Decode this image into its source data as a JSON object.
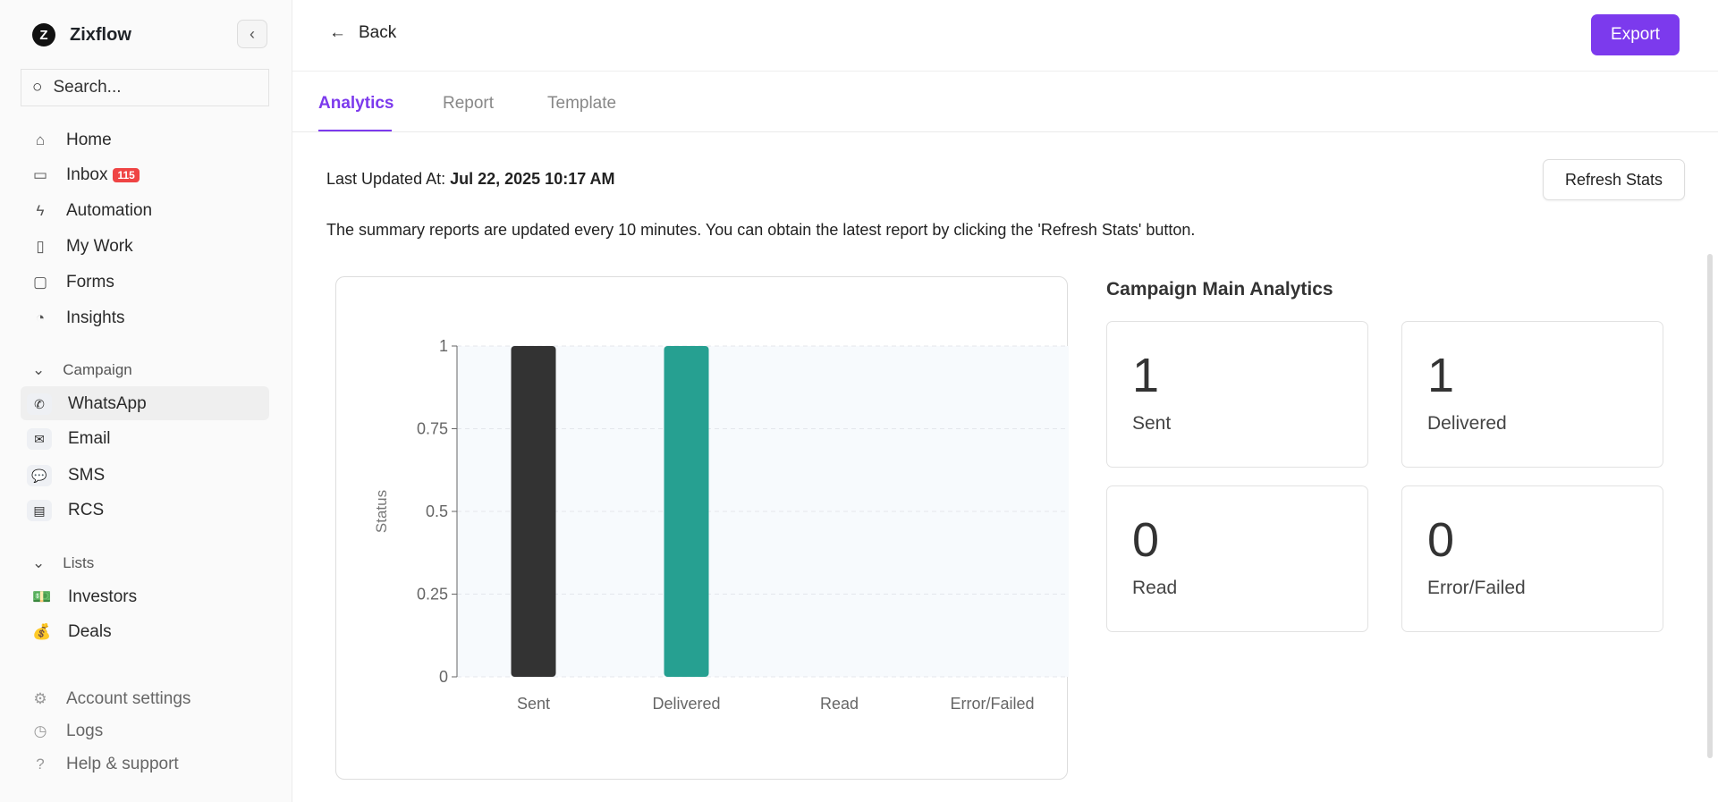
{
  "sidebar": {
    "brand": "Zixflow",
    "search_placeholder": "Search...",
    "nav": [
      {
        "label": "Home",
        "icon": "home-icon"
      },
      {
        "label": "Inbox",
        "icon": "inbox-icon",
        "badge": "115"
      },
      {
        "label": "Automation",
        "icon": "bolt-icon"
      },
      {
        "label": "My Work",
        "icon": "panel-icon"
      },
      {
        "label": "Forms",
        "icon": "file-icon"
      },
      {
        "label": "Insights",
        "icon": "pie-chart-icon"
      }
    ],
    "campaign_section": "Campaign",
    "campaign": [
      {
        "label": "WhatsApp",
        "icon": "whatsapp-icon",
        "active": true
      },
      {
        "label": "Email",
        "icon": "email-icon"
      },
      {
        "label": "SMS",
        "icon": "sms-icon"
      },
      {
        "label": "RCS",
        "icon": "rcs-icon"
      }
    ],
    "lists_section": "Lists",
    "lists": [
      {
        "label": "Investors",
        "icon": "money-icon"
      },
      {
        "label": "Deals",
        "icon": "money-bag-icon"
      }
    ],
    "footer": [
      {
        "label": "Account settings",
        "icon": "gear-icon"
      },
      {
        "label": "Logs",
        "icon": "clock-icon"
      },
      {
        "label": "Help & support",
        "icon": "help-icon"
      }
    ]
  },
  "header": {
    "back": "Back",
    "export": "Export",
    "accent": "#7c3aed"
  },
  "tabs": [
    {
      "label": "Analytics",
      "active": true
    },
    {
      "label": "Report"
    },
    {
      "label": "Template"
    }
  ],
  "main": {
    "last_updated_label": "Last Updated At:",
    "last_updated_value": "Jul 22, 2025 10:17 AM",
    "refresh": "Refresh Stats",
    "summary": "The summary reports are updated every 10 minutes. You can obtain the latest report by clicking the 'Refresh Stats' button.",
    "analytics_title": "Campaign Main Analytics",
    "cards": [
      {
        "value": "1",
        "label": "Sent"
      },
      {
        "value": "1",
        "label": "Delivered"
      },
      {
        "value": "0",
        "label": "Read"
      },
      {
        "value": "0",
        "label": "Error/Failed"
      }
    ]
  },
  "chart_data": {
    "type": "bar",
    "categories": [
      "Sent",
      "Delivered",
      "Read",
      "Error/Failed"
    ],
    "values": [
      1,
      1,
      0,
      0
    ],
    "ylabel": "Status",
    "ylim": [
      0,
      1
    ],
    "yticks": [
      "0",
      "0.25",
      "0.5",
      "0.75",
      "1"
    ],
    "colors": [
      "#333333",
      "#26a091",
      "#26a091",
      "#26a091"
    ],
    "grid": true
  }
}
